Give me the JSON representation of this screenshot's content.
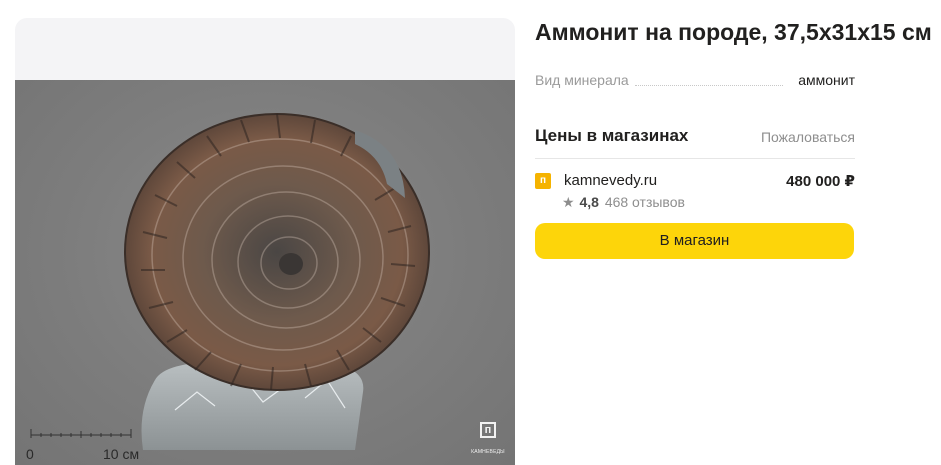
{
  "product": {
    "title": "Аммонит на породе, 37,5х31х15 см",
    "image_alt": "Аммонит на породе"
  },
  "image": {
    "scale_zero": "0",
    "scale_ten": "10 см",
    "watermark_text": "КАМНЕВЕДЫ",
    "watermark_icon": "п-logo-icon"
  },
  "specs": [
    {
      "name": "Вид минерала",
      "value": "аммонит"
    }
  ],
  "offers_section": {
    "title": "Цены в магазинах",
    "complain_label": "Пожаловаться"
  },
  "offer": {
    "shop_logo": "п",
    "shop_name": "kamnevedy.ru",
    "price": "480 000 ₽",
    "rating": "4,8",
    "reviews": "468 отзывов",
    "button_label": "В магазин"
  },
  "colors": {
    "button_yellow": "#fdd50a",
    "shop_logo_orange": "#f5b300",
    "photo_bg": "#7d7d7d"
  }
}
